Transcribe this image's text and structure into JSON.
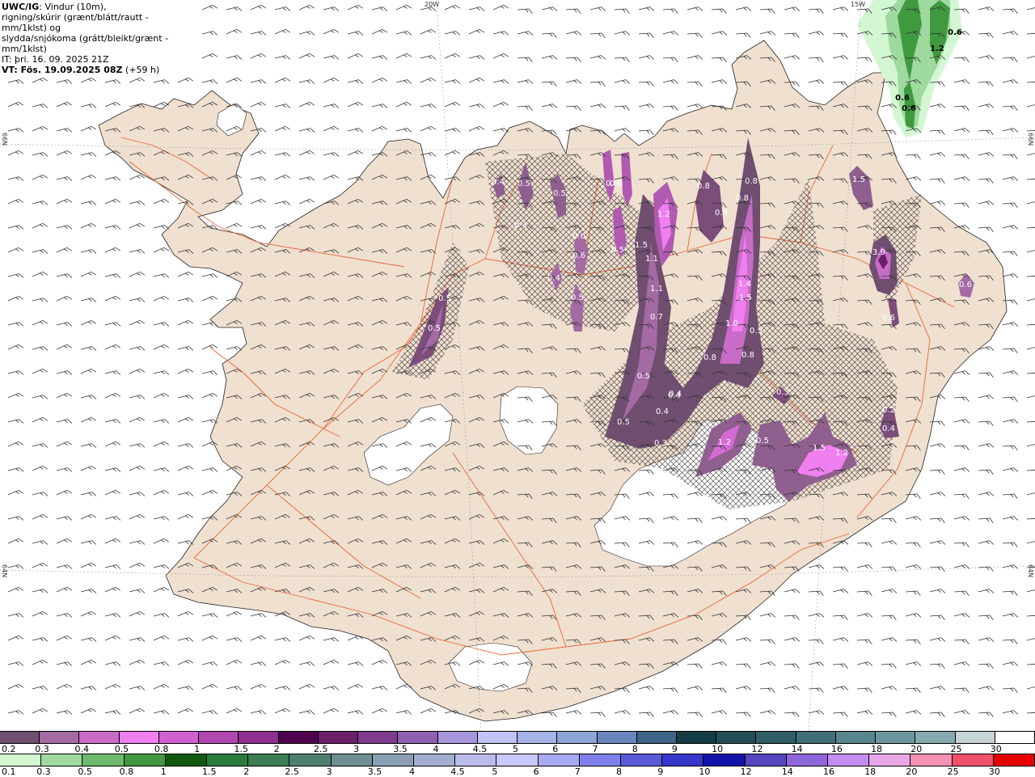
{
  "header": {
    "model": "UWC/IG",
    "line1_rest": ": Vindur (10m),",
    "line2": "rigning/skúrir (grænt/blátt/rautt - mm/1klst) og",
    "line3": "slydda/snjókoma (grátt/bleikt/grænt - mm/1klst)",
    "init_time": "IT: þri. 16. 09. 2025 21Z",
    "valid_time_bold": "VT: Fös. 19.09.2025 08Z",
    "valid_time_rest": " (+59 h)"
  },
  "grid_labels": {
    "lon_20w": "20W",
    "lon_15w": "15W",
    "lat_66n_left": "66N",
    "lat_66n_right": "66N",
    "lat_64n_left": "64N",
    "lat_64n_right": "64N"
  },
  "precip_labels": [
    "0.5",
    "0.5",
    "0.4",
    "0.6",
    "0.5",
    "0.5",
    "0.5",
    "0.4",
    "0.6",
    "0.6",
    "0.5",
    "0.4",
    "0.6",
    "0.8",
    "1.2",
    "1.5",
    "1.1",
    "1.1",
    "0.7",
    "0.5",
    "0.4",
    "0.9",
    "0.8",
    "0.8",
    "1.4",
    "1.5",
    "1.0",
    "0.5",
    "0.8",
    "0.8",
    "0.3",
    "0.5",
    "0.4",
    "0.4",
    "0.3",
    "1.2",
    "0.5",
    "1.5",
    "1.2",
    "1.5",
    "3.9",
    "0.6",
    "0.6",
    "0.2",
    "0.4",
    "0.6",
    "1.2",
    "0.6",
    "0.6"
  ],
  "snow_scale": {
    "labels": [
      "0.2",
      "0.3",
      "0.4",
      "0.5",
      "0.8",
      "1",
      "1.5",
      "2",
      "2.5",
      "3",
      "3.5",
      "4",
      "4.5",
      "5",
      "6",
      "7",
      "8",
      "9",
      "10",
      "12",
      "14",
      "16",
      "18",
      "20",
      "25",
      "30"
    ],
    "colors": [
      "#6f4e6f",
      "#a36aa3",
      "#c86cc8",
      "#f07ff0",
      "#d05fd0",
      "#b048b0",
      "#8f2f8f",
      "#4d004d",
      "#6a1f6a",
      "#7e3c8e",
      "#8f5fb0",
      "#a796dc",
      "#c3c3f5",
      "#a7b3e6",
      "#8ea3d6",
      "#6b86bd",
      "#3e6488",
      "#143c44",
      "#244d55",
      "#305e66",
      "#416f77",
      "#58868e",
      "#6d979e",
      "#87a9b0",
      "#c6d4d6",
      "#ffffff"
    ]
  },
  "rain_scale": {
    "labels": [
      "0.1",
      "0.3",
      "0.5",
      "0.8",
      "1",
      "1.5",
      "2",
      "2.5",
      "3",
      "3.5",
      "4",
      "4.5",
      "5",
      "6",
      "7",
      "8",
      "9",
      "10",
      "12",
      "14",
      "16",
      "18",
      "20",
      "25",
      "30"
    ],
    "colors": [
      "#d3f7d3",
      "#9ed99e",
      "#6dba6d",
      "#3f993f",
      "#0f5a0f",
      "#277d3c",
      "#3c7d55",
      "#507f70",
      "#6e8e90",
      "#8a9fb3",
      "#a3adcf",
      "#bbbbea",
      "#c9c9fb",
      "#a9a9f4",
      "#7f7fea",
      "#5a5ad9",
      "#3737cc",
      "#1212aa",
      "#5546c0",
      "#8f66d9",
      "#c38eef",
      "#e9a7e8",
      "#f58fb4",
      "#f0506e",
      "#e60000"
    ]
  },
  "colors": {
    "land": "#f0e0d0",
    "roads": "#e8663a",
    "wind": "#333333",
    "snow_light": "#6f4e6f"
  }
}
